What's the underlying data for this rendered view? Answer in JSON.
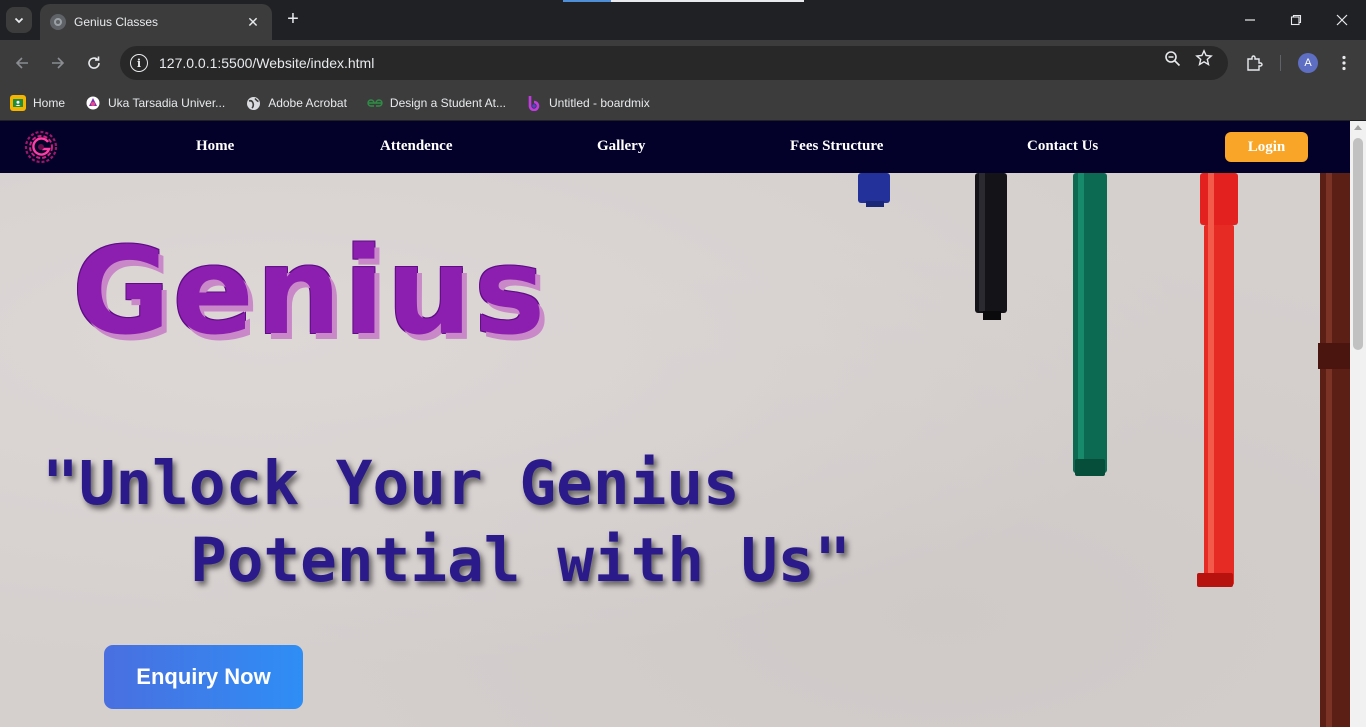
{
  "browser": {
    "tab_title": "Genius Classes",
    "url": "127.0.0.1:5500/Website/index.html",
    "profile_initial": "A",
    "bookmarks": [
      {
        "label": "Home",
        "icon": "classroom-icon"
      },
      {
        "label": "Uka Tarsadia Univer...",
        "icon": "university-icon"
      },
      {
        "label": "Adobe Acrobat",
        "icon": "globe-icon"
      },
      {
        "label": "Design a Student At...",
        "icon": "geeksforgeeks-icon"
      },
      {
        "label": "Untitled - boardmix",
        "icon": "boardmix-icon"
      }
    ]
  },
  "site": {
    "nav": {
      "links": [
        "Home",
        "Attendence",
        "Gallery",
        "Fees Structure",
        "Contact Us"
      ],
      "login_label": "Login"
    },
    "hero": {
      "title": "Genius",
      "tagline_line1": "\"Unlock Your Genius",
      "tagline_line2": "Potential with Us\"",
      "enquiry_label": "Enquiry Now"
    },
    "colors": {
      "nav_bg": "#03012a",
      "login_bg": "#f9a527",
      "title_color": "#8d1fb0",
      "tagline_color": "#2a1a8a",
      "enquiry_gradient_start": "#4a6fe0",
      "enquiry_gradient_end": "#2e8ef5"
    }
  }
}
